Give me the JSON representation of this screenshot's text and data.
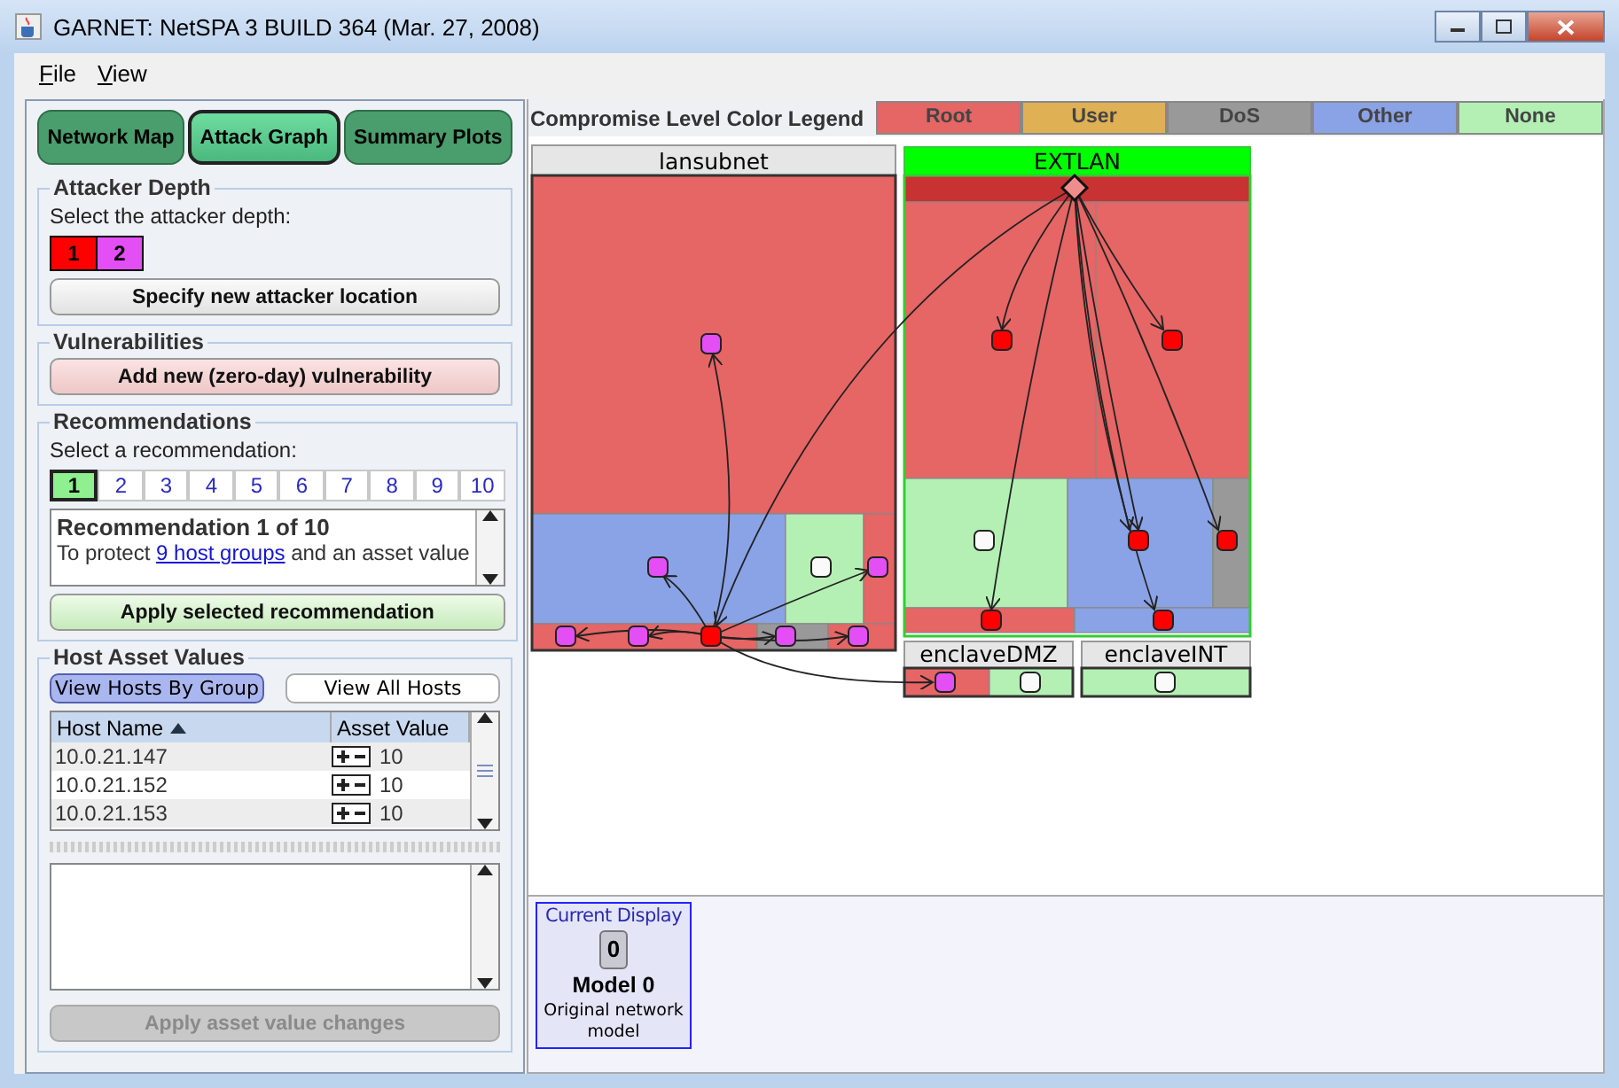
{
  "window": {
    "title": "GARNET: NetSPA 3 BUILD 364 (Mar. 27, 2008)"
  },
  "menu": [
    {
      "label": "File"
    },
    {
      "label": "View"
    }
  ],
  "view_tabs": [
    {
      "label": "Network Map",
      "selected": false
    },
    {
      "label": "Attack Graph",
      "selected": true
    },
    {
      "label": "Summary Plots",
      "selected": false
    }
  ],
  "attacker_depth": {
    "title": "Attacker Depth",
    "prompt": "Select the attacker depth:",
    "levels": [
      {
        "label": "1",
        "color": "#ff0000"
      },
      {
        "label": "2",
        "color": "#e34ef5"
      }
    ],
    "button": "Specify new attacker location"
  },
  "vulnerabilities": {
    "title": "Vulnerabilities",
    "button": "Add new (zero-day) vulnerability"
  },
  "recommendations": {
    "title": "Recommendations",
    "prompt": "Select a recommendation:",
    "numbers": [
      {
        "label": "1",
        "selected": true
      },
      {
        "label": "2",
        "selected": false
      },
      {
        "label": "3",
        "selected": false
      },
      {
        "label": "4",
        "selected": false
      },
      {
        "label": "5",
        "selected": false
      },
      {
        "label": "6",
        "selected": false
      },
      {
        "label": "7",
        "selected": false
      },
      {
        "label": "8",
        "selected": false
      },
      {
        "label": "9",
        "selected": false
      },
      {
        "label": "10",
        "selected": false
      }
    ],
    "heading": "Recommendation 1 of 10",
    "text_before": "To protect",
    "link": "9 host groups",
    "text_after": "and an asset value",
    "button": "Apply selected recommendation"
  },
  "host_assets": {
    "title": "Host Asset Values",
    "view_buttons": [
      {
        "label": "View Hosts By Group",
        "selected": true
      },
      {
        "label": "View All Hosts",
        "selected": false
      }
    ],
    "columns": [
      "Host Name",
      "Asset Value"
    ],
    "rows": [
      {
        "host": "10.0.21.147",
        "value": "10"
      },
      {
        "host": "10.0.21.152",
        "value": "10"
      },
      {
        "host": "10.0.21.153",
        "value": "10"
      }
    ],
    "button": {
      "label": "Apply asset value changes",
      "disabled": true
    }
  },
  "legend": {
    "title": "Compromise Level Color Legend",
    "levels": [
      {
        "label": "Root",
        "color": "#e66565"
      },
      {
        "label": "User",
        "color": "#e0b055"
      },
      {
        "label": "DoS",
        "color": "#999999"
      },
      {
        "label": "Other",
        "color": "#8aa2e6"
      },
      {
        "label": "None",
        "color": "#b4f0b4"
      }
    ]
  },
  "graph": {
    "subnets": [
      {
        "name": "lansubnet",
        "selected": false
      },
      {
        "name": "EXTLAN",
        "selected": true
      },
      {
        "name": "enclaveDMZ",
        "selected": false
      },
      {
        "name": "enclaveINT",
        "selected": false
      }
    ]
  },
  "model_card": {
    "caption": "Current Display",
    "number": "0",
    "name": "Model 0",
    "description": "Original network model"
  }
}
